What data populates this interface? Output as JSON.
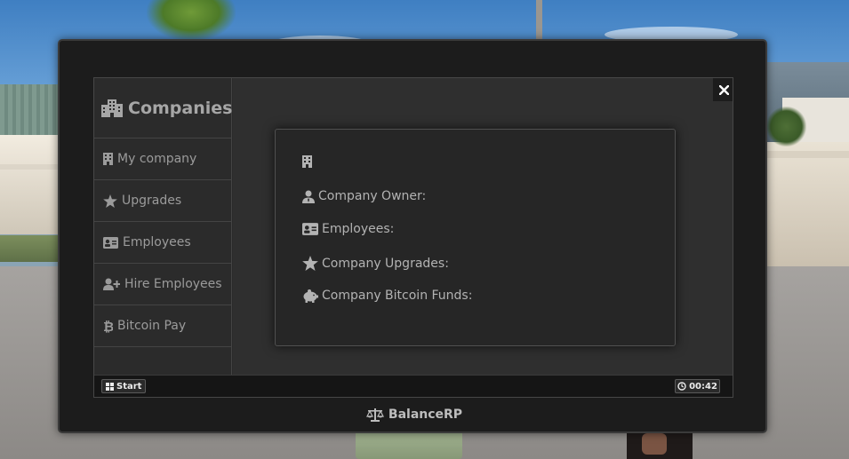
{
  "sidebar": {
    "title": "Companies",
    "title_icon": "buildings-icon",
    "items": [
      {
        "label": "My company",
        "icon": "office-building-icon"
      },
      {
        "label": "Upgrades",
        "icon": "star-icon"
      },
      {
        "label": "Employees",
        "icon": "id-card-icon"
      },
      {
        "label": "Hire Employees",
        "icon": "user-plus-icon"
      },
      {
        "label": "Bitcoin Pay",
        "icon": "bitcoin-icon"
      }
    ]
  },
  "company_card": {
    "header_icon": "office-building-icon",
    "owner_label": "Company Owner:",
    "employees_label": "Employees:",
    "upgrades_label": "Company Upgrades:",
    "funds_label": "Company Bitcoin Funds:"
  },
  "window": {
    "close_icon": "close-icon"
  },
  "taskbar": {
    "start_label": "Start",
    "clock_text": "00:42"
  },
  "brand": {
    "name": "BalanceRP",
    "icon": "scale-icon"
  },
  "colors": {
    "tablet_bezel": "#1c1c1c",
    "sidebar_bg": "#2b2b2b",
    "content_bg": "#2f2f2f",
    "card_bg": "#262626",
    "text_muted": "#9b9b9b"
  }
}
